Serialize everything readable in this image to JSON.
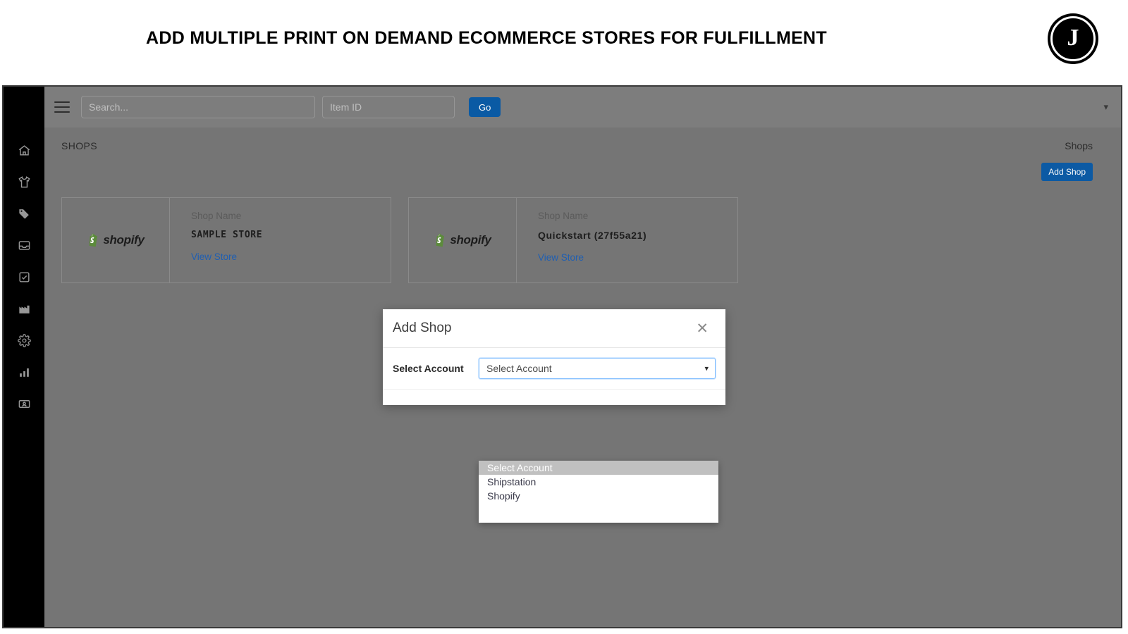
{
  "banner": {
    "title": "ADD MULTIPLE PRINT ON DEMAND ECOMMERCE STORES FOR FULFILLMENT",
    "logo_letter": "J"
  },
  "navbar": {
    "menu_icon": "hamburger-icon",
    "search_placeholder": "Search...",
    "search_value": "",
    "item_id_placeholder": "Item ID",
    "item_id_value": "",
    "go_label": "Go",
    "caret_icon": "chevron-down-icon"
  },
  "sidebar": {
    "items": [
      {
        "icon": "home-icon",
        "label": "Home"
      },
      {
        "icon": "tshirt-icon",
        "label": "Products"
      },
      {
        "icon": "tag-icon",
        "label": "Tags"
      },
      {
        "icon": "inbox-icon",
        "label": "Inbox"
      },
      {
        "icon": "task-checkbox-icon",
        "label": "Tasks"
      },
      {
        "icon": "factory-icon",
        "label": "Production"
      },
      {
        "icon": "gear-icon",
        "label": "Settings"
      },
      {
        "icon": "bar-chart-icon",
        "label": "Reports"
      },
      {
        "icon": "id-card-icon",
        "label": "Accounts"
      }
    ]
  },
  "page": {
    "title": "SHOPS",
    "breadcrumb": "Shops",
    "add_shop_label": "Add Shop"
  },
  "shops": [
    {
      "provider": "shopify",
      "provider_label": "shopify",
      "shop_name_label": "Shop Name",
      "shop_name": "SAMPLE STORE",
      "link_label": "View Store"
    },
    {
      "provider": "shopify",
      "provider_label": "shopify",
      "shop_name_label": "Shop Name",
      "shop_name": "Quickstart (27f55a21)",
      "link_label": "View Store"
    }
  ],
  "modal": {
    "title": "Add Shop",
    "close_icon": "close-icon",
    "field_label": "Select Account",
    "select_value": "Select Account",
    "caret_icon": "chevron-down-icon",
    "options": [
      {
        "label": "Select Account",
        "selected": true
      },
      {
        "label": "Shipstation",
        "selected": false
      },
      {
        "label": "Shopify",
        "selected": false
      }
    ]
  },
  "colors": {
    "accent_blue": "#0d5ca8",
    "link_blue": "#2161b5",
    "shopify_green": "#5e8e3e",
    "sidebar_black": "#000000",
    "navbar_gray": "#808080",
    "content_gray": "#787878",
    "focus_blue": "#80bdff",
    "option_highlight": "#c0c0c0"
  }
}
